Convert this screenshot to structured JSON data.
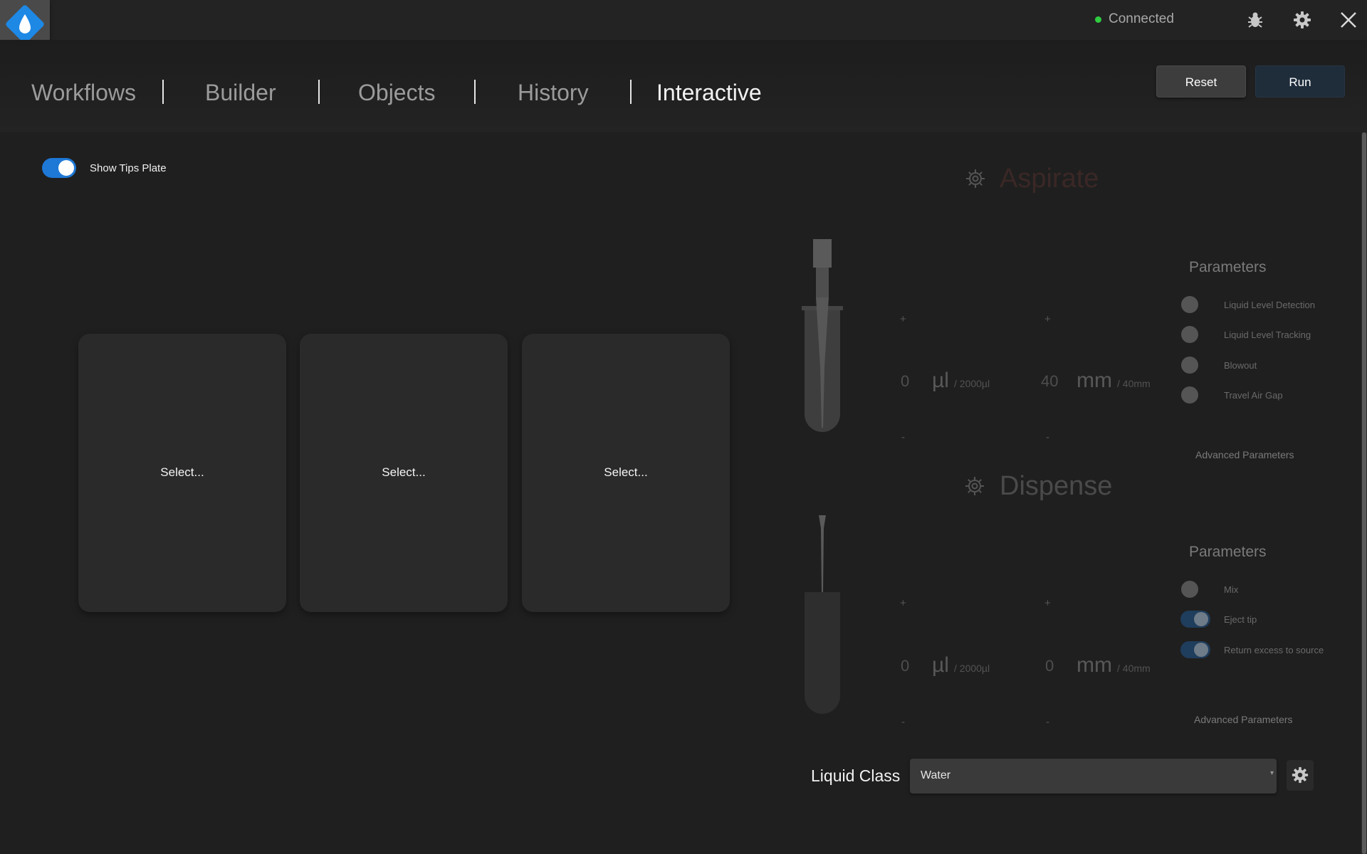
{
  "window": {
    "status_text": "Connected",
    "status_color": "#2ecc40",
    "icons": [
      "bug-icon",
      "gear-icon",
      "close-icon"
    ]
  },
  "nav": {
    "tabs": [
      {
        "label": "Workflows"
      },
      {
        "label": "Builder"
      },
      {
        "label": "Objects"
      },
      {
        "label": "History"
      },
      {
        "label": "Interactive",
        "active": true
      }
    ],
    "reset_label": "Reset",
    "run_label": "Run"
  },
  "tips_toggle": {
    "label": "Show Tips Plate",
    "on": true
  },
  "slots": [
    {
      "label": "Select..."
    },
    {
      "label": "Select..."
    },
    {
      "label": "Select..."
    }
  ],
  "aspirate": {
    "title": "Aspirate",
    "title_color": "#3a2826",
    "plus": "+",
    "minus": "-",
    "volume_value": "0",
    "volume_unit": "µl",
    "volume_max": "/ 2000µl",
    "depth_value": "40",
    "depth_unit": "mm",
    "depth_max": "/ 40mm",
    "params_title": "Parameters",
    "params": [
      {
        "label": "Liquid Level Detection",
        "on": false
      },
      {
        "label": "Liquid Level Tracking",
        "on": false
      },
      {
        "label": "Blowout",
        "on": false
      },
      {
        "label": "Travel Air Gap",
        "on": false
      }
    ],
    "advanced_label": "Advanced Parameters"
  },
  "dispense": {
    "title": "Dispense",
    "title_color": "#4a4a4a",
    "plus": "+",
    "minus": "-",
    "volume_value": "0",
    "volume_unit": "µl",
    "volume_max": "/ 2000µl",
    "depth_value": "0",
    "depth_unit": "mm",
    "depth_max": "/ 40mm",
    "params_title": "Parameters",
    "params": [
      {
        "label": "Mix",
        "on": false
      },
      {
        "label": "Eject tip",
        "on": true
      },
      {
        "label": "Return excess to source",
        "on": true
      }
    ],
    "advanced_label": "Advanced Parameters"
  },
  "liquid_class": {
    "label": "Liquid Class",
    "value": "Water"
  }
}
